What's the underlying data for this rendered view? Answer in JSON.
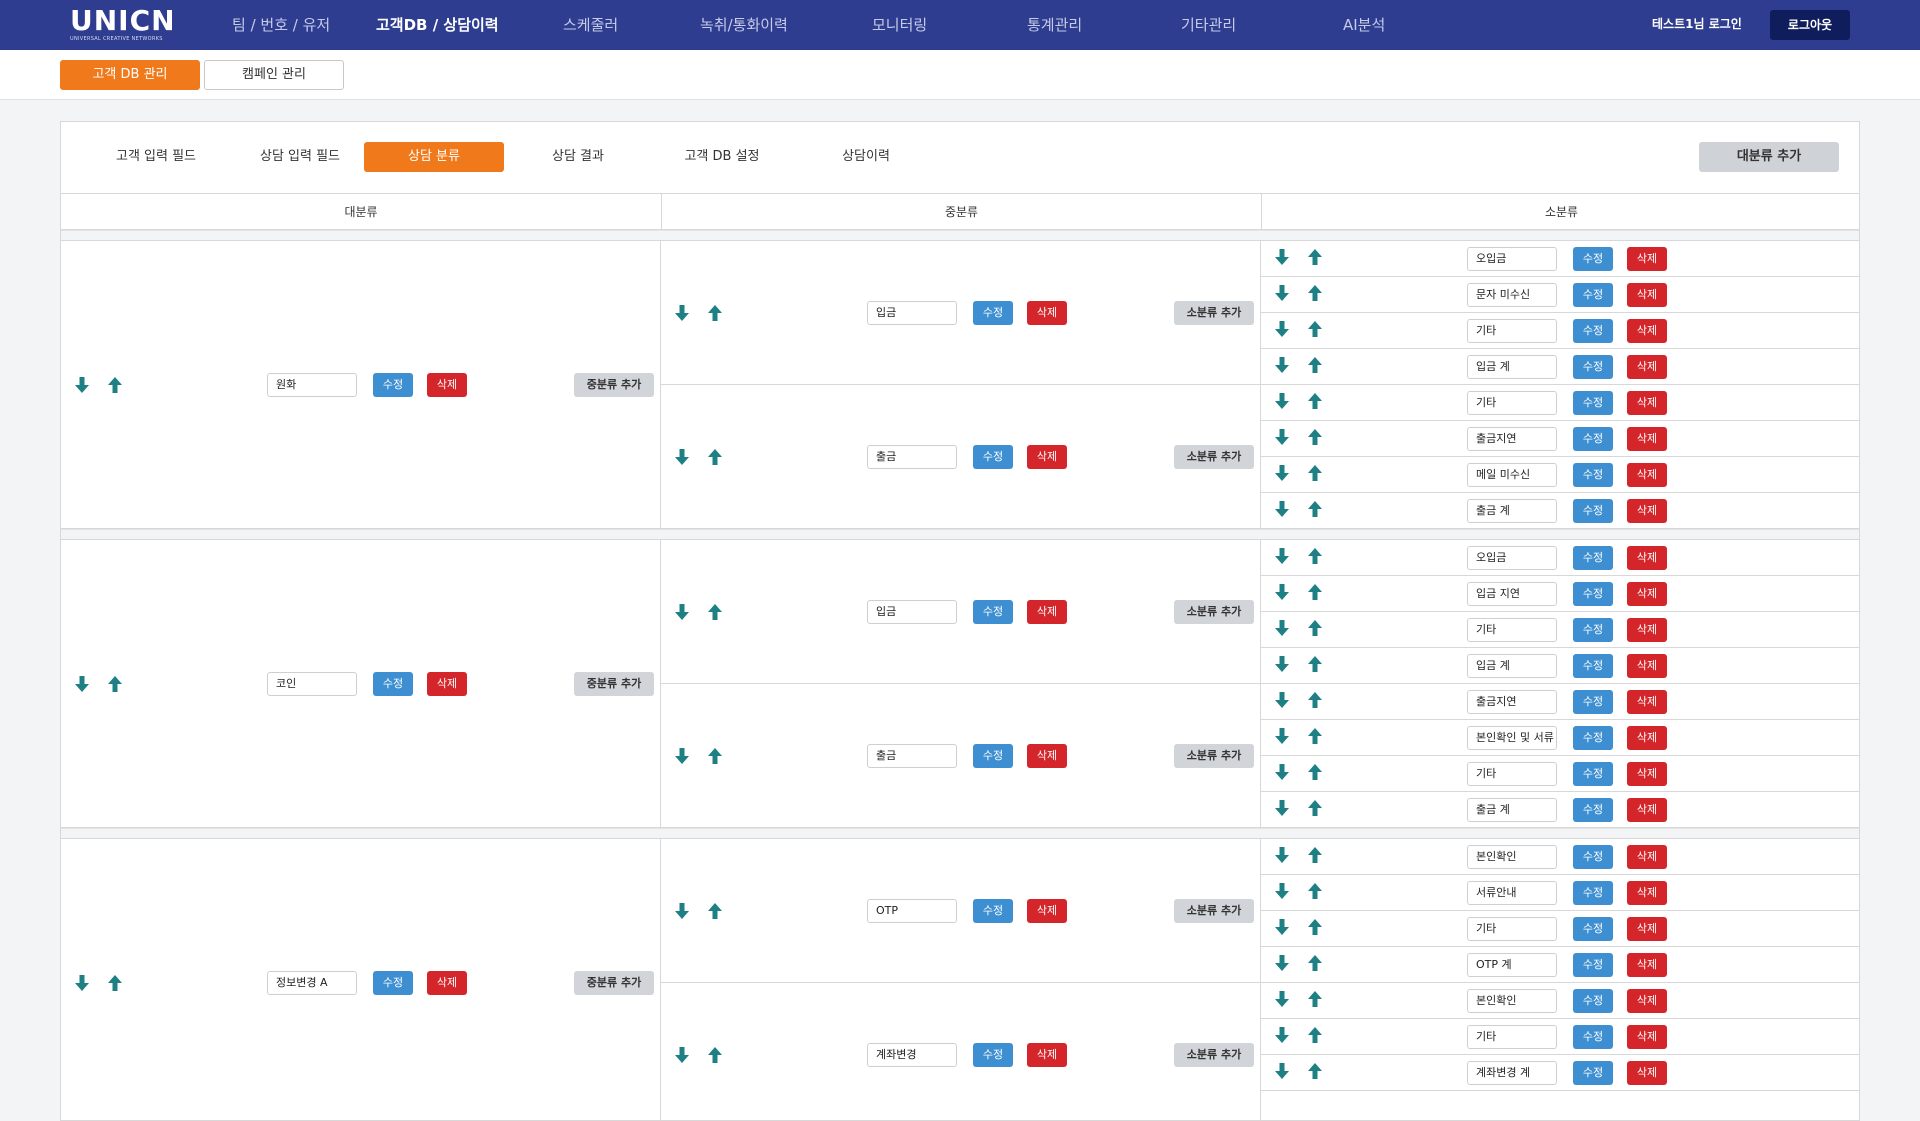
{
  "header": {
    "logo_text": "UNICN",
    "logo_sub": "UNIVERSAL CREATIVE NETWORKS",
    "nav": [
      "팀 / 번호 / 유저",
      "고객DB / 상담이력",
      "스케줄러",
      "녹취/통화이력",
      "모니터링",
      "통계관리",
      "기타관리",
      "AI분석"
    ],
    "active_nav": "고객DB / 상담이력",
    "user_text": "테스트1님 로그인",
    "logout_label": "로그아웃"
  },
  "subnav": {
    "tabs": [
      "고객 DB 관리",
      "캠페인 관리"
    ],
    "active": "고객 DB 관리"
  },
  "panel": {
    "tabs": [
      "고객 입력 필드",
      "상담 입력 필드",
      "상담 분류",
      "상담 결과",
      "고객 DB 설정",
      "상담이력"
    ],
    "active_tab": "상담 분류",
    "add_major_label": "대분류 추가",
    "columns": [
      "대분류",
      "중분류",
      "소분류"
    ]
  },
  "labels": {
    "edit": "수정",
    "delete": "삭제",
    "add_mid": "중분류 추가",
    "add_minor": "소분류 추가"
  },
  "icons": {
    "down": "arrow-down-icon",
    "up": "arrow-up-icon"
  },
  "colors": {
    "header_bg": "#2e3d8f",
    "accent": "#f07a1b",
    "edit": "#3d8fd1",
    "delete": "#d4262a",
    "arrow": "#1e8085"
  },
  "categories": [
    {
      "name": "원화",
      "mids": [
        {
          "name": "입금",
          "minors": [
            "오입금",
            "문자 미수신",
            "기타",
            "입금 계"
          ]
        },
        {
          "name": "출금",
          "minors": [
            "기타",
            "출금지연",
            "메일 미수신",
            "출금 계"
          ]
        }
      ]
    },
    {
      "name": "코인",
      "mids": [
        {
          "name": "입금",
          "minors": [
            "오입금",
            "입금 지연",
            "기타",
            "입금 계"
          ]
        },
        {
          "name": "출금",
          "minors": [
            "출금지연",
            "본인확인 및 서류",
            "기타",
            "출금 계"
          ]
        }
      ]
    },
    {
      "name": "정보변경 A",
      "mids": [
        {
          "name": "OTP",
          "minors": [
            "본인확인",
            "서류안내",
            "기타",
            "OTP 계"
          ]
        },
        {
          "name": "계좌변경",
          "minors": [
            "본인확인",
            "기타",
            "계좌변경 계"
          ]
        }
      ]
    }
  ]
}
